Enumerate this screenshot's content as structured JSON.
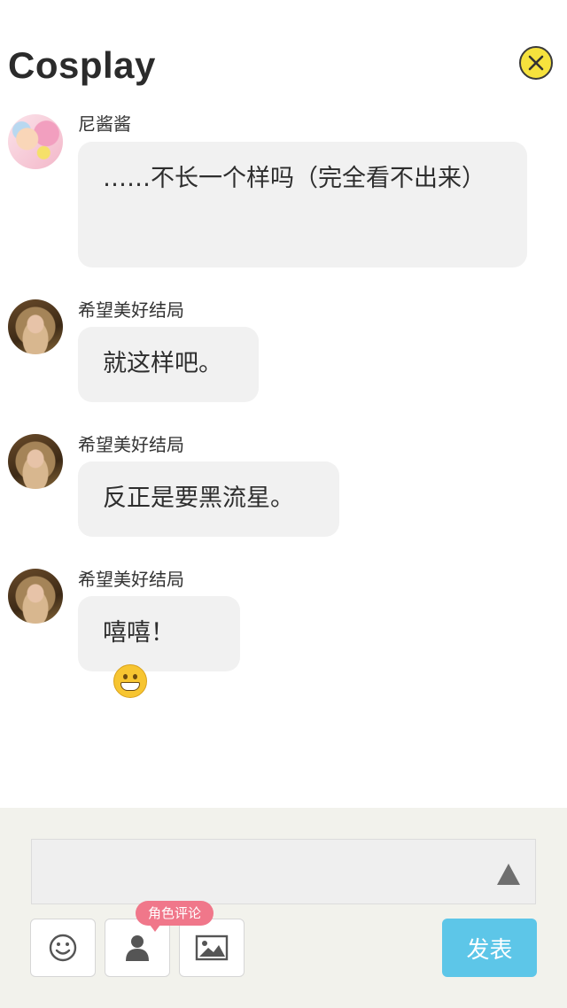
{
  "header": {
    "title": "Cosplay",
    "close_icon": "close-icon"
  },
  "messages": [
    {
      "user": "尼酱酱",
      "avatar": "avatar-pink-character",
      "text": "……不长一个样吗（完全看不出来）"
    },
    {
      "user": "希望美好结局",
      "avatar": "avatar-brown-figure",
      "text": "就这样吧。"
    },
    {
      "user": "希望美好结局",
      "avatar": "avatar-brown-figure",
      "text": "反正是要黑流星。"
    },
    {
      "user": "希望美好结局",
      "avatar": "avatar-brown-figure",
      "text": "嘻嘻！",
      "emoji": "grinning-face-icon"
    }
  ],
  "composer": {
    "input_value": "",
    "expand_icon": "triangle-up-icon",
    "tools": [
      {
        "icon": "smiley-icon"
      },
      {
        "icon": "person-icon",
        "tag": "角色评论"
      },
      {
        "icon": "image-icon"
      }
    ],
    "publish_label": "发表"
  },
  "colors": {
    "close_bg": "#f6e23d",
    "bubble_bg": "#f1f1f1",
    "footer_bg": "#f2f2ec",
    "tag_bg": "#f0778a",
    "publish_bg": "#5dc6e8"
  }
}
